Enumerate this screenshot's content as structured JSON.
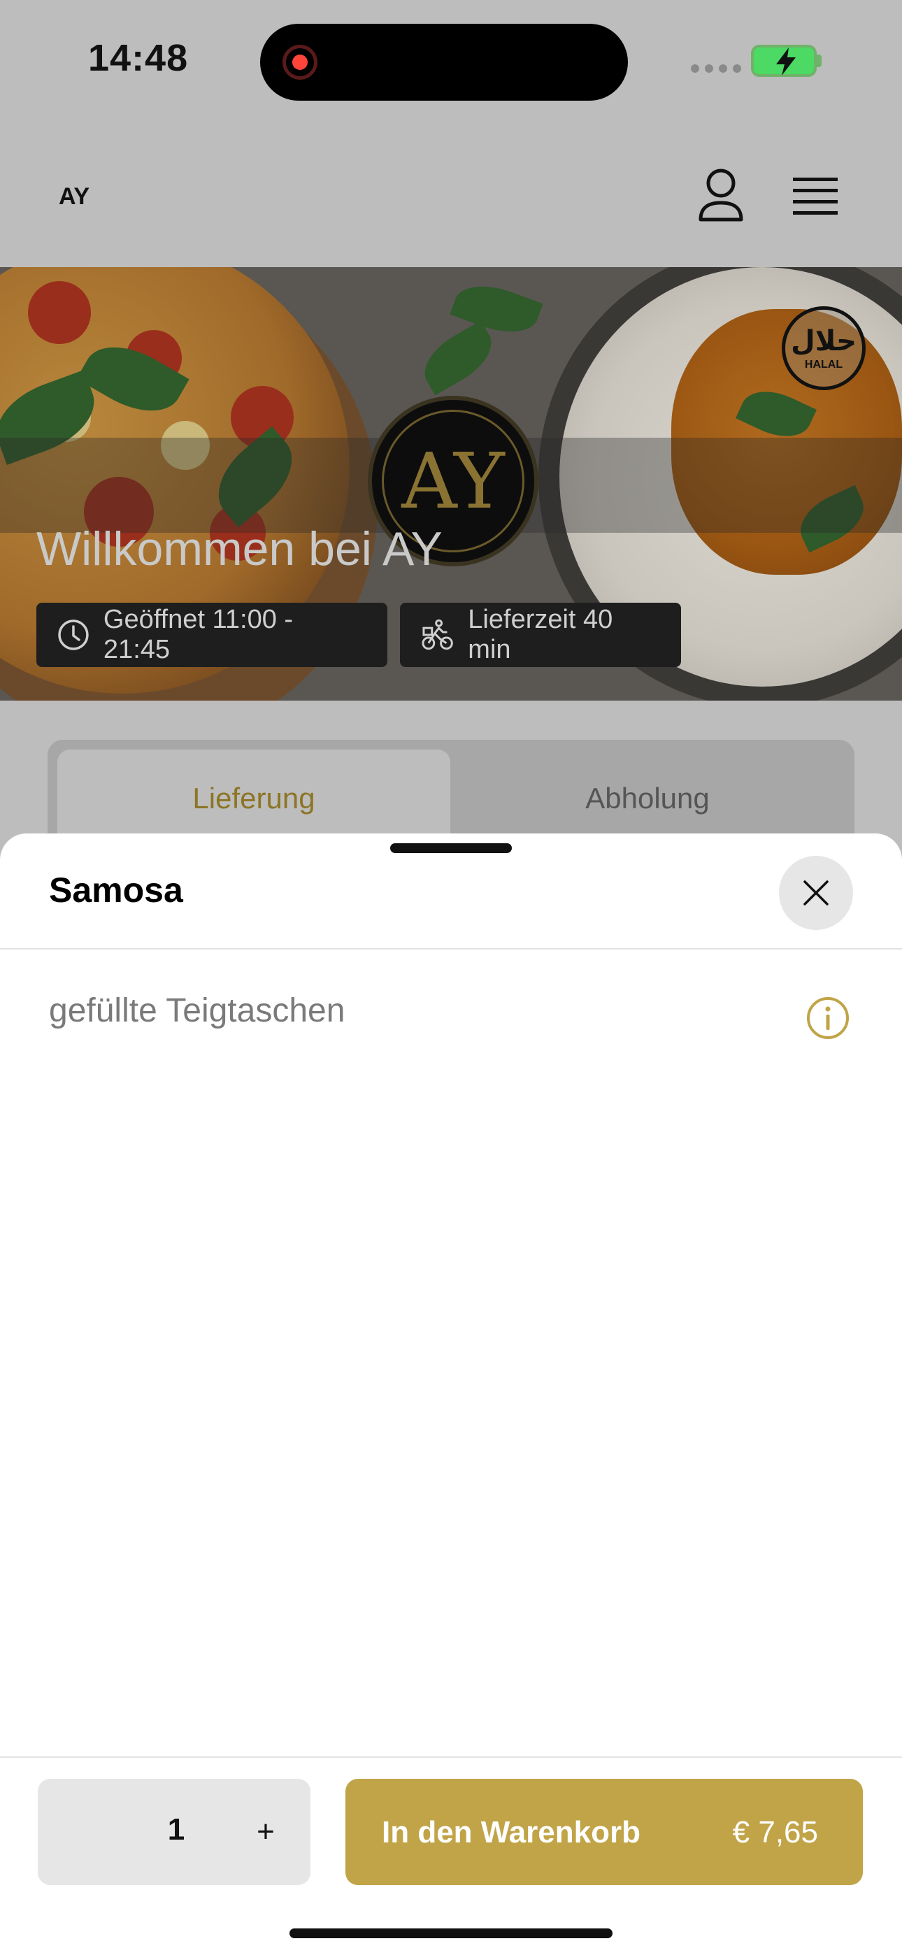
{
  "status_bar": {
    "time": "14:48"
  },
  "header": {
    "brand": "AY"
  },
  "hero": {
    "logo_text": "AY",
    "halal_arabic": "حلال",
    "halal_label": "HALAL",
    "welcome": "Willkommen bei AY",
    "open_hours": "Geöffnet 11:00 - 21:45",
    "delivery_time": "Lieferzeit 40 min"
  },
  "tabs": [
    {
      "label": "Lieferung",
      "active": true
    },
    {
      "label": "Abholung",
      "active": false
    }
  ],
  "sheet": {
    "title": "Samosa",
    "description": "gefüllte Teigtaschen",
    "quantity": "1",
    "plus": "+",
    "add_to_cart": "In den Warenkorb",
    "price": "€ 7,65"
  },
  "colors": {
    "accent": "#c1a447",
    "accent_text": "#8d7526",
    "overlay_background": "#bdbdbd",
    "sheet_background": "#ffffff"
  },
  "icons": [
    "record-icon",
    "signal-icon",
    "battery-charging-icon",
    "user-icon",
    "menu-icon",
    "halal-badge-icon",
    "clock-icon",
    "bicycle-courier-icon",
    "close-icon",
    "info-icon"
  ]
}
